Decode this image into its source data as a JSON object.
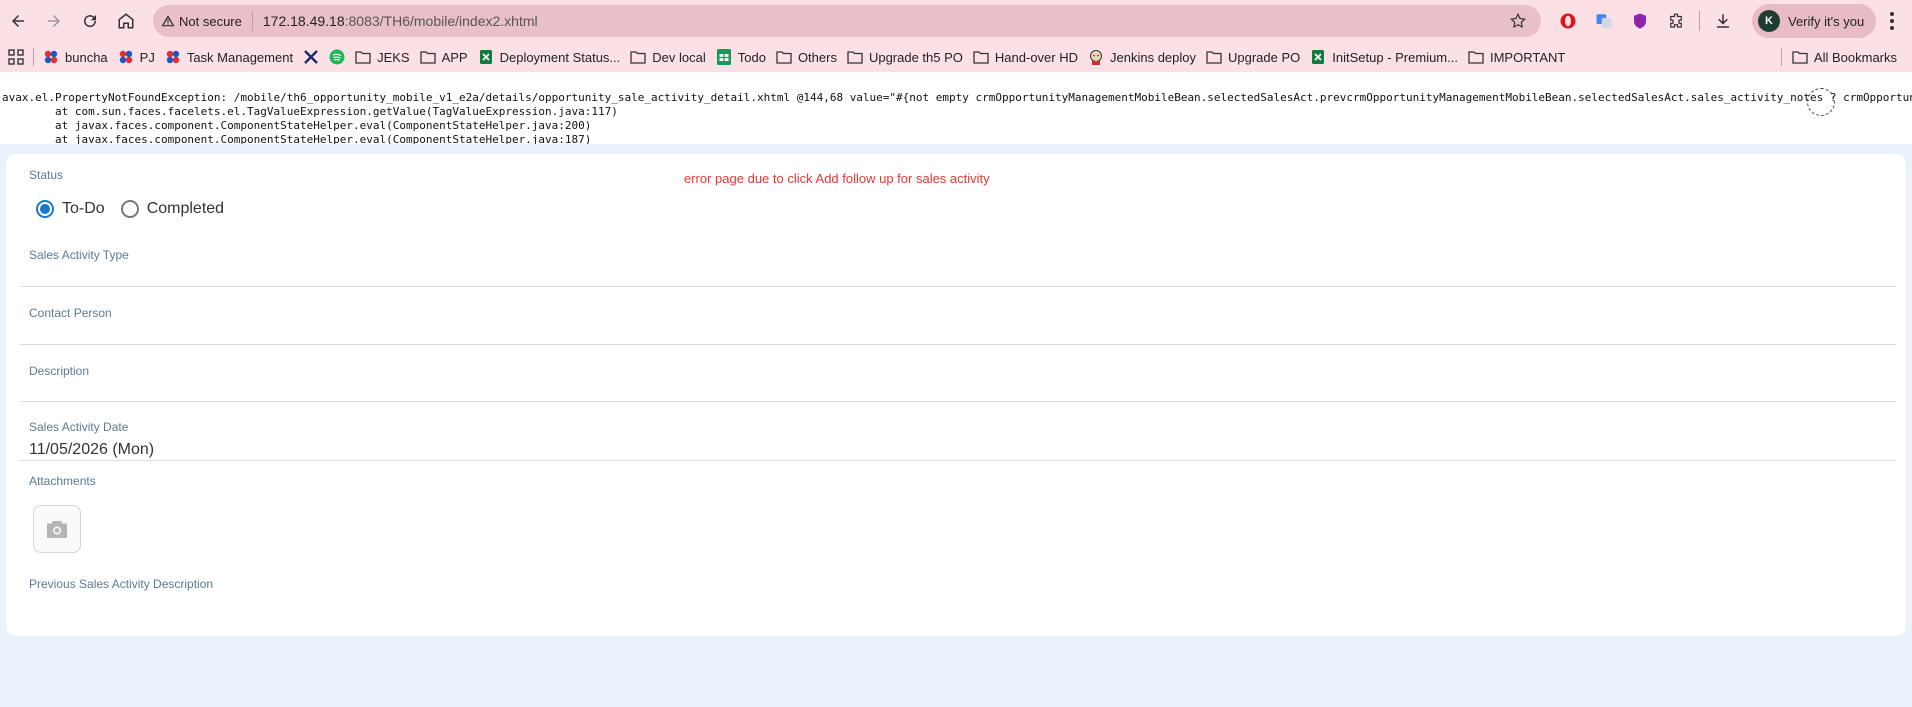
{
  "browser": {
    "security_label": "Not secure",
    "url_host": "172.18.49.18",
    "url_rest": ":8083/TH6/mobile/index2.xhtml",
    "verify_label": "Verify it's you",
    "avatar_letter": "K"
  },
  "bookmarks": [
    {
      "label": "buncha",
      "icon": "dots-icon"
    },
    {
      "label": "PJ",
      "icon": "dots-icon"
    },
    {
      "label": "Task Management",
      "icon": "dots-icon"
    },
    {
      "label": "",
      "icon": "x-logo-icon"
    },
    {
      "label": "",
      "icon": "spotify-icon"
    },
    {
      "label": "JEKS",
      "icon": "folder-icon"
    },
    {
      "label": "APP",
      "icon": "folder-icon"
    },
    {
      "label": "Deployment Status...",
      "icon": "sheet-icon"
    },
    {
      "label": "Dev local",
      "icon": "folder-icon"
    },
    {
      "label": "Todo",
      "icon": "sheet-green-icon"
    },
    {
      "label": "Others",
      "icon": "folder-icon"
    },
    {
      "label": "Upgrade th5 PO",
      "icon": "folder-icon"
    },
    {
      "label": "Hand-over HD",
      "icon": "folder-icon"
    },
    {
      "label": "Jenkins deploy",
      "icon": "jenkins-icon"
    },
    {
      "label": "Upgrade PO",
      "icon": "folder-icon"
    },
    {
      "label": "InitSetup - Premium...",
      "icon": "sheet-icon"
    },
    {
      "label": "IMPORTANT",
      "icon": "folder-icon"
    }
  ],
  "all_bookmarks_label": "All Bookmarks",
  "trace": {
    "line1": "avax.el.PropertyNotFoundException: /mobile/th6_opportunity_mobile_v1_e2a/details/opportunity_sale_activity_detail.xhtml @144,68 value=\"#{not empty crmOpportunityManagementMobileBean.selectedSalesAct.prevcrmOpportunityManagementMobileBean.selectedSalesAct.sales_activity_notes ? crmOpportuni",
    "line2": "\tat com.sun.faces.facelets.el.TagValueExpression.getValue(TagValueExpression.java:117)",
    "line3": "\tat javax.faces.component.ComponentStateHelper.eval(ComponentStateHelper.java:200)",
    "line4": "\tat javax.faces.component.ComponentStateHelper.eval(ComponentStateHelper.java:187)"
  },
  "form": {
    "note": "error page due to click Add follow up for sales activity",
    "status_label": "Status",
    "status_options": [
      "To-Do",
      "Completed"
    ],
    "status_selected": "To-Do",
    "sales_activity_type_label": "Sales Activity Type",
    "contact_person_label": "Contact Person",
    "description_label": "Description",
    "sales_activity_date_label": "Sales Activity Date",
    "sales_activity_date_value": "11/05/2026 (Mon)",
    "attachments_label": "Attachments",
    "previous_description_label": "Previous Sales Activity Description"
  }
}
